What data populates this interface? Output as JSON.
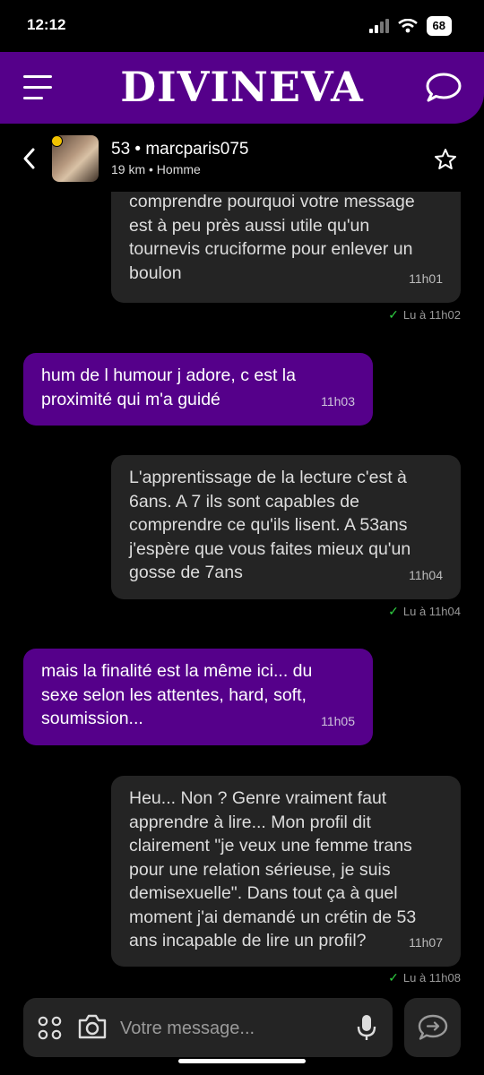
{
  "status_bar": {
    "time": "12:12",
    "battery": "68"
  },
  "app": {
    "brand": "DIVINEVA"
  },
  "conversation": {
    "name": "53 • marcparis075",
    "subtitle": "19 km • Homme"
  },
  "messages": [
    {
      "direction": "in",
      "text": "comprendre pourquoi votre message\nest à peu près aussi utile qu'un\ntournevis cruciforme pour enlever un\nboulon",
      "time": "11h01",
      "read": "Lu à 11h02"
    },
    {
      "direction": "out",
      "text": "hum de l humour j adore, c est la\nproximité qui m'a guidé",
      "time": "11h03"
    },
    {
      "direction": "in",
      "text": "L'apprentissage de la lecture c'est à\n6ans. A 7 ils sont capables de\ncomprendre ce qu'ils lisent. A 53ans\nj'espère que vous faites mieux qu'un\ngosse de 7ans",
      "time": "11h04",
      "read": "Lu à 11h04"
    },
    {
      "direction": "out",
      "text": "mais la finalité est la même ici... du\nsexe selon les attentes, hard, soft,\nsoumission...",
      "time": "11h05"
    },
    {
      "direction": "in",
      "text": "Heu... Non ? Genre vraiment faut\napprendre à lire... Mon profil dit\nclairement \"je veux une femme trans\npour une relation sérieuse, je suis\ndemisexuelle\". Dans tout ça à quel\nmoment j'ai demandé un crétin de 53\nans incapable de lire un profil?",
      "time": "11h07",
      "read": "Lu à 11h08"
    }
  ],
  "composer": {
    "placeholder": "Votre message..."
  },
  "colors": {
    "brand_purple": "#55008a",
    "bubble_dark": "#242424",
    "read_check": "#2ecc40"
  }
}
